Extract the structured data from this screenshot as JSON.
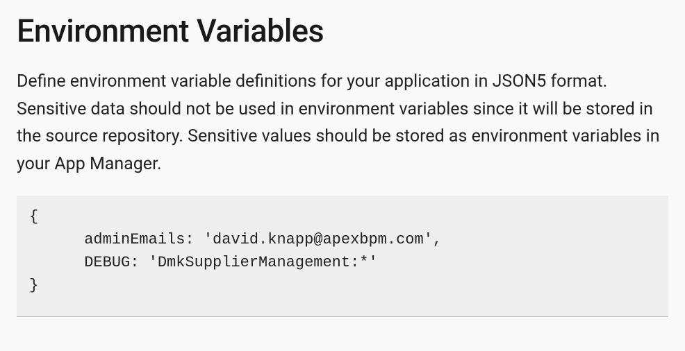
{
  "heading": "Environment Variables",
  "description": "Define environment variable definitions for your application in JSON5 format. Sensitive data should not be used in environment variables since it will be stored in the source repository. Sensitive values should be stored as environment variables in your App Manager.",
  "code": "{\n      adminEmails: 'david.knapp@apexbpm.com',\n      DEBUG: 'DmkSupplierManagement:*'\n}"
}
